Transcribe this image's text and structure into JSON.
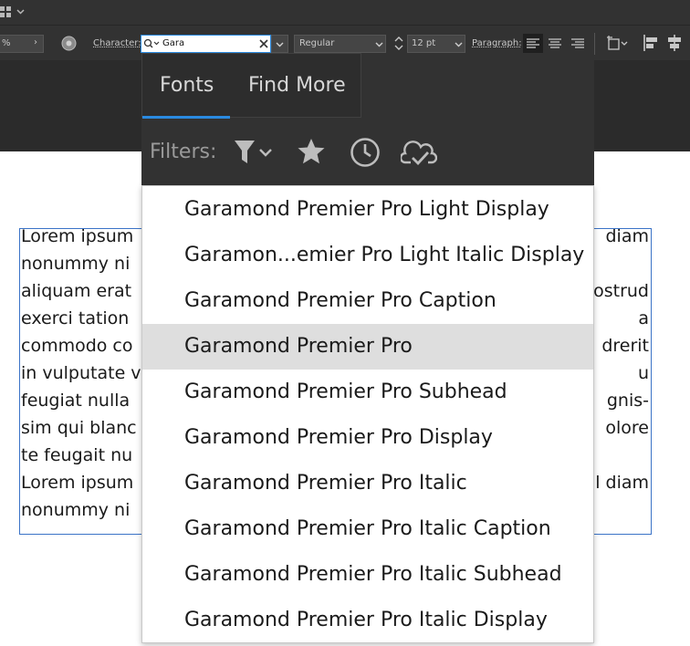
{
  "toolbar": {
    "percent": "%",
    "character_label": "Character:",
    "search_value": "Gara",
    "style_value": "Regular",
    "size_value": "12 pt",
    "paragraph_label": "Paragraph:"
  },
  "popup": {
    "tabs": [
      {
        "label": "Fonts"
      },
      {
        "label": "Find More"
      }
    ],
    "filters_label": "Filters:"
  },
  "fonts": [
    {
      "label": "Garamond Premier Pro Light Display"
    },
    {
      "label": "Garamon...emier Pro Light Italic Display"
    },
    {
      "label": "Garamond Premier Pro Caption"
    },
    {
      "label": "Garamond Premier Pro",
      "selected": true
    },
    {
      "label": "Garamond Premier Pro Subhead"
    },
    {
      "label": "Garamond Premier Pro Display"
    },
    {
      "label": "Garamond Premier Pro Italic"
    },
    {
      "label": "Garamond Premier Pro Italic Caption"
    },
    {
      "label": "Garamond Premier Pro Italic Subhead"
    },
    {
      "label": "Garamond Premier Pro Italic Display"
    }
  ],
  "document": {
    "left_lines": [
      "Lorem ipsum",
      "nonummy ni",
      "aliquam erat",
      "exerci tation",
      "commodo co",
      "in vulputate v",
      "feugiat nulla",
      "sim qui blanc",
      "te feugait nu",
      "Lorem ipsum",
      "nonummy ni"
    ],
    "right_lines": [
      "diam",
      "",
      "ostrud",
      "a",
      "drerit",
      "u",
      "gnis-",
      "olore",
      "",
      "l diam",
      ""
    ]
  },
  "colors": {
    "accent": "#2a8ae0",
    "selection": "#dedede",
    "frame": "#3b73c7"
  }
}
